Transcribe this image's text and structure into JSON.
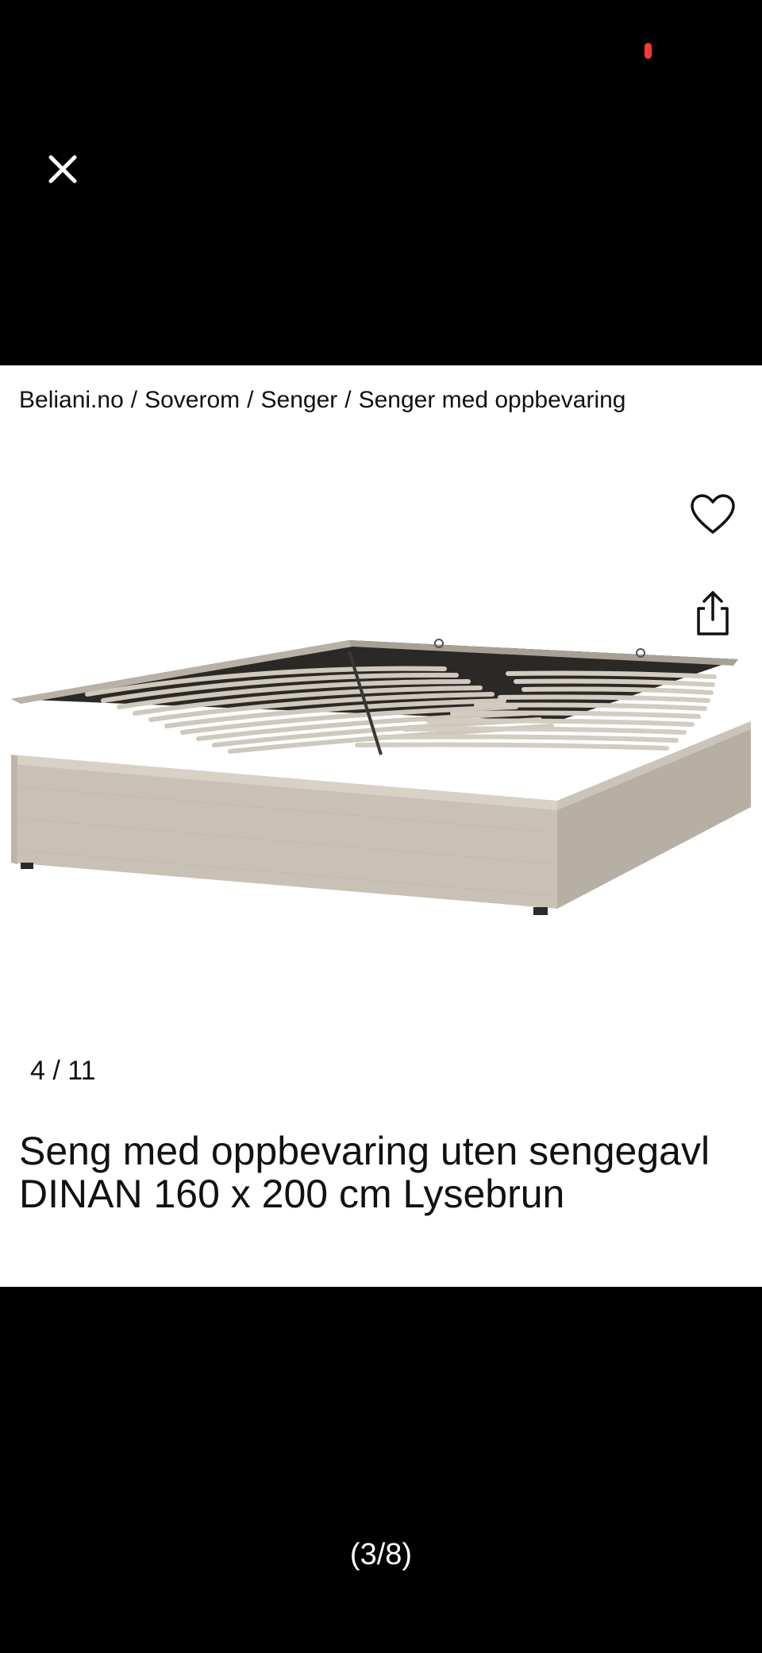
{
  "breadcrumb": {
    "items": [
      "Beliani.no",
      "Soverom",
      "Senger",
      "Senger med oppbevaring"
    ],
    "separator": "/"
  },
  "gallery": {
    "counter": "4 / 11"
  },
  "product": {
    "title": "Seng med oppbevaring uten sengegavl DINAN 160 x 200 cm Lysebrun"
  },
  "viewer": {
    "page_indicator": "(3/8)"
  },
  "icons": {
    "close": "close-icon",
    "favorite": "heart-icon",
    "share": "share-icon"
  },
  "colors": {
    "background": "#000000",
    "card": "#ffffff",
    "text": "#111111",
    "record_indicator": "#ff3b30",
    "fabric": "#c9c1b6"
  }
}
